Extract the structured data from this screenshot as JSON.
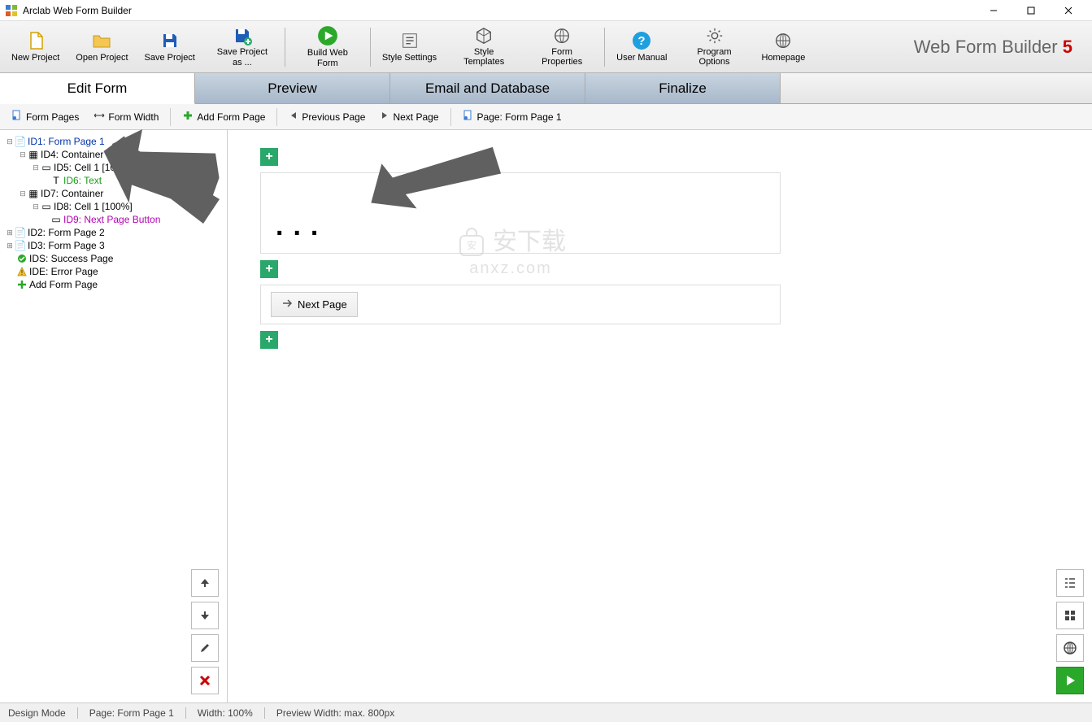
{
  "app": {
    "title": "Arclab Web Form Builder"
  },
  "brand": {
    "name": "Web Form Builder",
    "version": "5"
  },
  "toolbar": {
    "new_project": "New Project",
    "open_project": "Open Project",
    "save_project": "Save Project",
    "save_project_as": "Save Project as ...",
    "build_web_form": "Build Web Form",
    "style_settings": "Style Settings",
    "style_templates": "Style Templates",
    "form_properties": "Form Properties",
    "user_manual": "User Manual",
    "program_options": "Program Options",
    "homepage": "Homepage"
  },
  "tabs": {
    "edit_form": "Edit Form",
    "preview": "Preview",
    "email_db": "Email and Database",
    "finalize": "Finalize"
  },
  "subtoolbar": {
    "form_pages": "Form Pages",
    "form_width": "Form Width",
    "add_form_page": "Add Form Page",
    "previous_page": "Previous Page",
    "next_page": "Next Page",
    "page_label": "Page: Form Page 1"
  },
  "tree": {
    "n1": "ID1: Form Page 1",
    "n2": "ID4: Container",
    "n3": "ID5: Cell 1 [100%]",
    "n4": "ID6: Text",
    "n5": "ID7: Container",
    "n6": "ID8: Cell 1 [100%]",
    "n7": "ID9: Next Page Button",
    "n8": "ID2: Form Page 2",
    "n9": "ID3: Form Page 3",
    "n10": "IDS: Success Page",
    "n11": "IDE: Error Page",
    "n12": "Add Form Page"
  },
  "canvas": {
    "text_placeholder": "...",
    "next_page_btn": "Next Page"
  },
  "status": {
    "mode": "Design Mode",
    "page": "Page: Form Page 1",
    "width": "Width: 100%",
    "preview_width": "Preview Width: max. 800px"
  },
  "watermark": {
    "line1": "安下载",
    "line2": "anxz.com"
  }
}
